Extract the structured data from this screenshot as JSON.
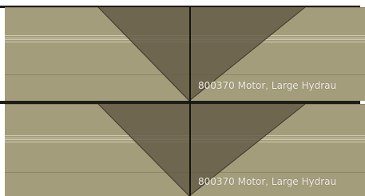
{
  "timeline": {
    "clips": [
      {
        "name": "800370 Motor, Large Hydrau"
      },
      {
        "name": "800370 Motor, Large Hydrau"
      }
    ]
  },
  "colors": {
    "clip_fill": "#a49d7c",
    "fade_fill": "#615a46",
    "track_edge": "#1f1d18",
    "text": "#f2efe6"
  },
  "icons": {
    "fade_handle": "crossfade-triangle",
    "playhead": "playhead-line"
  }
}
